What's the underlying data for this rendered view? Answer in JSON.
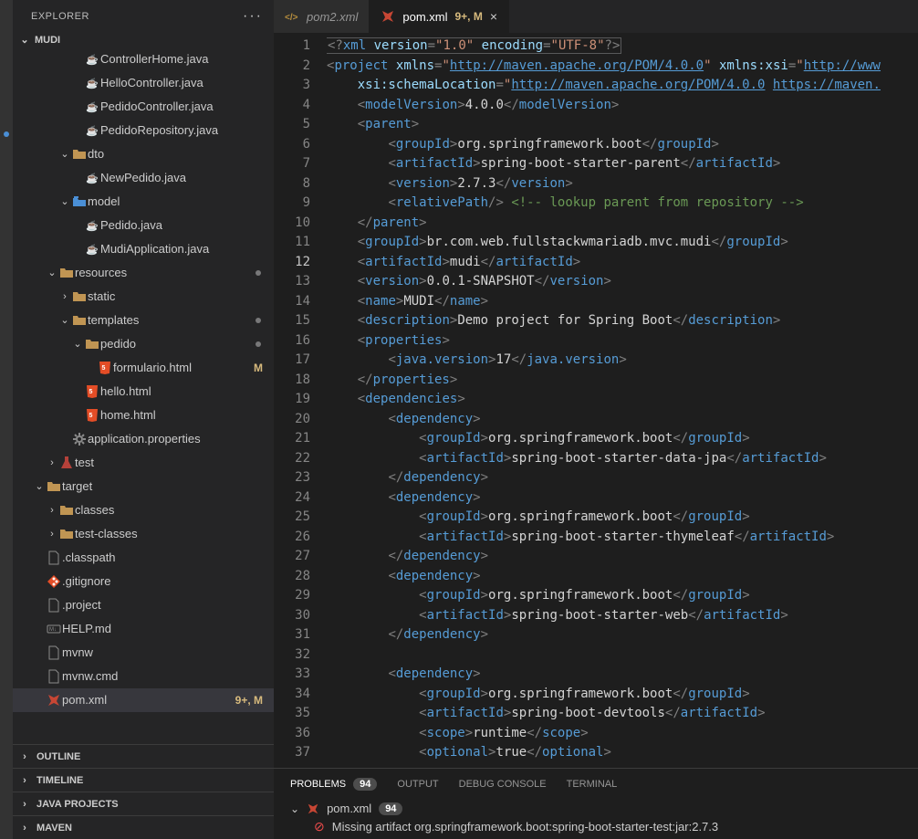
{
  "explorer": {
    "title": "EXPLORER",
    "project": "MUDI"
  },
  "tree": [
    {
      "depth": 4,
      "type": "java",
      "label": "ControllerHome.java",
      "chev": ""
    },
    {
      "depth": 4,
      "type": "java",
      "label": "HelloController.java",
      "chev": ""
    },
    {
      "depth": 4,
      "type": "java",
      "label": "PedidoController.java",
      "chev": ""
    },
    {
      "depth": 4,
      "type": "java",
      "label": "PedidoRepository.java",
      "chev": ""
    },
    {
      "depth": 3,
      "type": "folder",
      "label": "dto",
      "chev": "v"
    },
    {
      "depth": 4,
      "type": "java",
      "label": "NewPedido.java",
      "chev": ""
    },
    {
      "depth": 3,
      "type": "model",
      "label": "model",
      "chev": "v"
    },
    {
      "depth": 4,
      "type": "java",
      "label": "Pedido.java",
      "chev": ""
    },
    {
      "depth": 4,
      "type": "java",
      "label": "MudiApplication.java",
      "chev": ""
    },
    {
      "depth": 2,
      "type": "folder",
      "label": "resources",
      "chev": "v",
      "dot": true
    },
    {
      "depth": 3,
      "type": "folder",
      "label": "static",
      "chev": ">"
    },
    {
      "depth": 3,
      "type": "folder",
      "label": "templates",
      "chev": "v",
      "dot": true
    },
    {
      "depth": 4,
      "type": "folder",
      "label": "pedido",
      "chev": "v",
      "dot": true
    },
    {
      "depth": 5,
      "type": "html",
      "label": "formulario.html",
      "badge": "M",
      "chev": ""
    },
    {
      "depth": 4,
      "type": "html",
      "label": "hello.html",
      "chev": ""
    },
    {
      "depth": 4,
      "type": "html",
      "label": "home.html",
      "chev": ""
    },
    {
      "depth": 3,
      "type": "gear",
      "label": "application.properties",
      "chev": ""
    },
    {
      "depth": 2,
      "type": "test",
      "label": "test",
      "chev": ">"
    },
    {
      "depth": 1,
      "type": "folder",
      "label": "target",
      "chev": "v"
    },
    {
      "depth": 2,
      "type": "folder",
      "label": "classes",
      "chev": ">"
    },
    {
      "depth": 2,
      "type": "folder",
      "label": "test-classes",
      "chev": ">"
    },
    {
      "depth": 1,
      "type": "file",
      "label": ".classpath",
      "chev": ""
    },
    {
      "depth": 1,
      "type": "git",
      "label": ".gitignore",
      "chev": ""
    },
    {
      "depth": 1,
      "type": "file",
      "label": ".project",
      "chev": ""
    },
    {
      "depth": 1,
      "type": "md",
      "label": "HELP.md",
      "chev": ""
    },
    {
      "depth": 1,
      "type": "file",
      "label": "mvnw",
      "chev": ""
    },
    {
      "depth": 1,
      "type": "file",
      "label": "mvnw.cmd",
      "chev": ""
    },
    {
      "depth": 1,
      "type": "maven",
      "label": "pom.xml",
      "badge": "9+, M",
      "sel": true,
      "chev": ""
    }
  ],
  "sections": [
    {
      "label": "OUTLINE"
    },
    {
      "label": "TIMELINE"
    },
    {
      "label": "JAVA PROJECTS"
    },
    {
      "label": "MAVEN"
    }
  ],
  "tabs": [
    {
      "icon": "xml",
      "label": "pom2.xml",
      "active": false
    },
    {
      "icon": "maven",
      "label": "pom.xml",
      "badge": "9+, M",
      "active": true,
      "close": true
    }
  ],
  "code": {
    "first_line": 1,
    "active_line": 12,
    "lines": 37
  },
  "panel": {
    "tabs": [
      {
        "label": "PROBLEMS",
        "count": "94",
        "active": true
      },
      {
        "label": "OUTPUT"
      },
      {
        "label": "DEBUG CONSOLE"
      },
      {
        "label": "TERMINAL"
      }
    ],
    "file": "pom.xml",
    "file_count": "94",
    "error_start": "Missing artifact org.springframework.boot:spring-boot-starter-test:jar:2.7.3"
  },
  "pom": {
    "xml_decl": {
      "version": "1.0",
      "encoding": "UTF-8"
    },
    "xmlns": "http://maven.apache.org/POM/4.0.0",
    "xmlns_xsi": "http://www",
    "schemaLocation_a": "http://maven.apache.org/POM/4.0.0",
    "schemaLocation_b": "https://maven.",
    "modelVersion": "4.0.0",
    "parent": {
      "groupId": "org.springframework.boot",
      "artifactId": "spring-boot-starter-parent",
      "version": "2.7.3",
      "comment": "<!-- lookup parent from repository -->"
    },
    "groupId": "br.com.web.fullstackwmariadb.mvc.mudi",
    "artifactId": "mudi",
    "version": "0.0.1-SNAPSHOT",
    "name": "MUDI",
    "description": "Demo project for Spring Boot",
    "javaVersion": "17",
    "dependencies": [
      {
        "groupId": "org.springframework.boot",
        "artifactId": "spring-boot-starter-data-jpa"
      },
      {
        "groupId": "org.springframework.boot",
        "artifactId": "spring-boot-starter-thymeleaf"
      },
      {
        "groupId": "org.springframework.boot",
        "artifactId": "spring-boot-starter-web"
      },
      {
        "groupId": "org.springframework.boot",
        "artifactId": "spring-boot-devtools",
        "scope": "runtime",
        "optional": "true"
      }
    ]
  }
}
